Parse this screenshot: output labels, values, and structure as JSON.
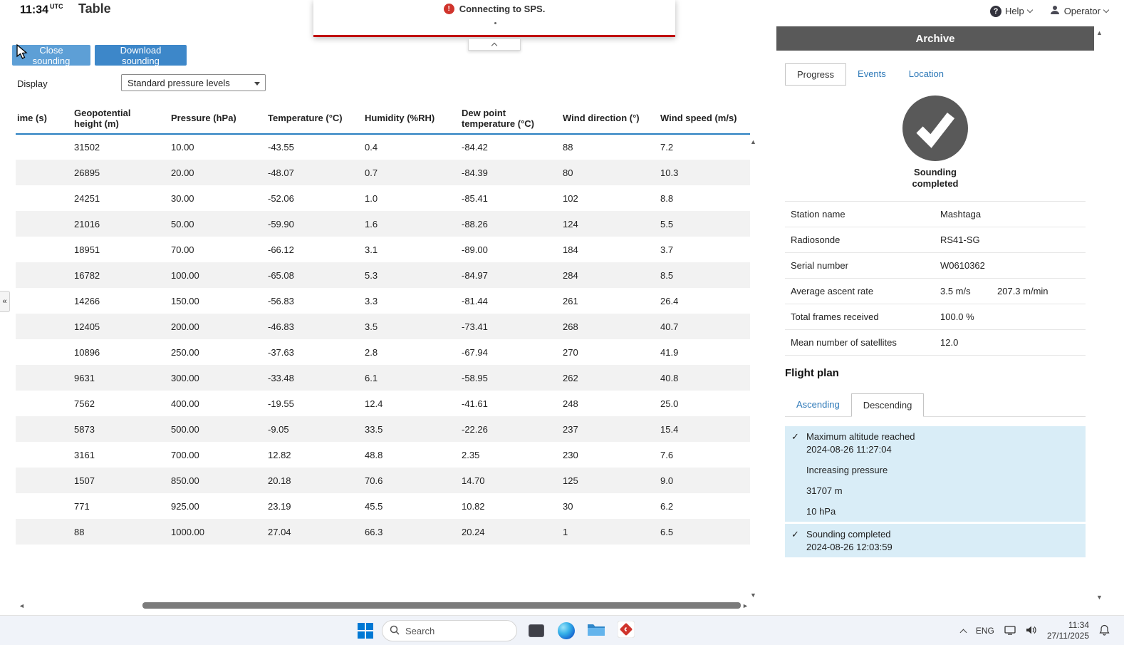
{
  "colors": {
    "error_red": "#c00000",
    "panel_header": "#595959",
    "link": "#2e79b8",
    "underline": "#2a7fc1",
    "event_bg": "#d9edf7",
    "btn_close": "#5d9fd6",
    "btn_download": "#3d87c9",
    "alt_row": "#f2f2f2"
  },
  "icons": {
    "error": "!",
    "help": "?",
    "check": "✓",
    "collapse_left": "«",
    "scroll_up": "▲",
    "scroll_down": "▼",
    "scroll_left": "◄",
    "scroll_right": "►"
  },
  "topbar": {
    "time": "11:34",
    "time_zone": "UTC",
    "title": "Table",
    "help_label": "Help",
    "operator_label": "Operator"
  },
  "toast": {
    "message": "Connecting to SPS."
  },
  "toolbar": {
    "close_button": "Close sounding",
    "download_button": "Download sounding",
    "display_label": "Display",
    "display_value": "Standard pressure levels"
  },
  "table": {
    "columns": [
      "ime (s)",
      "Geopotential height (m)",
      "Pressure (hPa)",
      "Temperature (°C)",
      "Humidity (%RH)",
      "Dew point temperature (°C)",
      "Wind direction (°)",
      "Wind speed (m/s)"
    ],
    "rows": [
      [
        "",
        "31502",
        "10.00",
        "-43.55",
        "0.4",
        "-84.42",
        "88",
        "7.2"
      ],
      [
        "",
        "26895",
        "20.00",
        "-48.07",
        "0.7",
        "-84.39",
        "80",
        "10.3"
      ],
      [
        "",
        "24251",
        "30.00",
        "-52.06",
        "1.0",
        "-85.41",
        "102",
        "8.8"
      ],
      [
        "",
        "21016",
        "50.00",
        "-59.90",
        "1.6",
        "-88.26",
        "124",
        "5.5"
      ],
      [
        "",
        "18951",
        "70.00",
        "-66.12",
        "3.1",
        "-89.00",
        "184",
        "3.7"
      ],
      [
        "",
        "16782",
        "100.00",
        "-65.08",
        "5.3",
        "-84.97",
        "284",
        "8.5"
      ],
      [
        "",
        "14266",
        "150.00",
        "-56.83",
        "3.3",
        "-81.44",
        "261",
        "26.4"
      ],
      [
        "",
        "12405",
        "200.00",
        "-46.83",
        "3.5",
        "-73.41",
        "268",
        "40.7"
      ],
      [
        "",
        "10896",
        "250.00",
        "-37.63",
        "2.8",
        "-67.94",
        "270",
        "41.9"
      ],
      [
        "",
        "9631",
        "300.00",
        "-33.48",
        "6.1",
        "-58.95",
        "262",
        "40.8"
      ],
      [
        "",
        "7562",
        "400.00",
        "-19.55",
        "12.4",
        "-41.61",
        "248",
        "25.0"
      ],
      [
        "",
        "5873",
        "500.00",
        "-9.05",
        "33.5",
        "-22.26",
        "237",
        "15.4"
      ],
      [
        "",
        "3161",
        "700.00",
        "12.82",
        "48.8",
        "2.35",
        "230",
        "7.6"
      ],
      [
        "",
        "1507",
        "850.00",
        "20.18",
        "70.6",
        "14.70",
        "125",
        "9.0"
      ],
      [
        "",
        "771",
        "925.00",
        "23.19",
        "45.5",
        "10.82",
        "30",
        "6.2"
      ],
      [
        "",
        "88",
        "1000.00",
        "27.04",
        "66.3",
        "20.24",
        "1",
        "6.5"
      ]
    ]
  },
  "archive": {
    "title": "Archive",
    "tabs": [
      "Progress",
      "Events",
      "Location"
    ],
    "active_tab": "Progress",
    "status_text": "Sounding completed",
    "details": [
      {
        "label": "Station name",
        "value": "Mashtaga",
        "extra": ""
      },
      {
        "label": "Radiosonde",
        "value": "RS41-SG",
        "extra": ""
      },
      {
        "label": "Serial number",
        "value": "W0610362",
        "extra": ""
      },
      {
        "label": "Average ascent rate",
        "value": "3.5 m/s",
        "extra": "207.3 m/min"
      },
      {
        "label": "Total frames received",
        "value": "100.0 %",
        "extra": ""
      },
      {
        "label": "Mean number of satellites",
        "value": "12.0",
        "extra": ""
      }
    ],
    "flight_plan": {
      "title": "Flight plan",
      "tabs": [
        "Ascending",
        "Descending"
      ],
      "active_tab": "Descending",
      "events": [
        {
          "checked": true,
          "title": "Maximum altitude reached",
          "subtitle": "2024-08-26 11:27:04",
          "gap_before": false
        },
        {
          "checked": false,
          "title": "Increasing pressure",
          "subtitle": "",
          "gap_before": false
        },
        {
          "checked": false,
          "title": "31707 m",
          "subtitle": "",
          "gap_before": false
        },
        {
          "checked": false,
          "title": "10 hPa",
          "subtitle": "",
          "gap_before": false
        },
        {
          "checked": true,
          "title": "Sounding completed",
          "subtitle": "2024-08-26 12:03:59",
          "gap_before": true
        }
      ]
    }
  },
  "taskbar": {
    "search_placeholder": "Search",
    "language": "ENG",
    "time": "11:34",
    "date": "27/11/2025"
  }
}
